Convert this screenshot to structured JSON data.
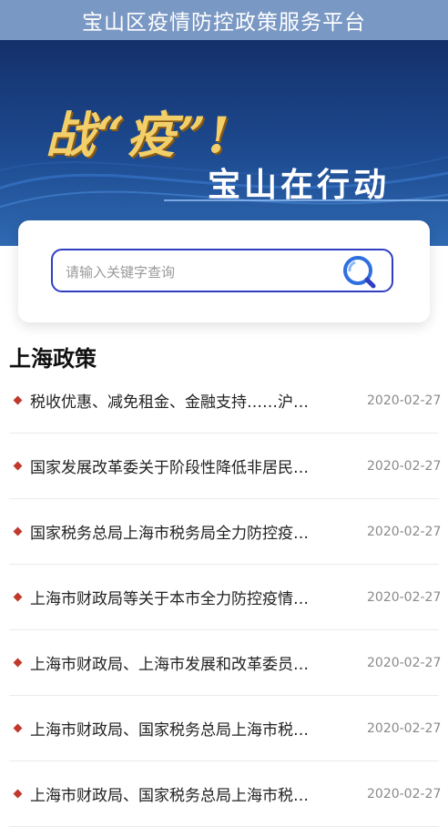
{
  "header": {
    "title": "宝山区疫情防控政策服务平台"
  },
  "banner": {
    "slogan_main": "战“疫”!",
    "slogan_sub": "宝山在行动"
  },
  "search": {
    "placeholder": "请输入关键字查询",
    "value": ""
  },
  "section": {
    "title": "上海政策"
  },
  "news": [
    {
      "title": "税收优惠、减免租金、金融支持……沪…",
      "date": "2020-02-27"
    },
    {
      "title": "国家发展改革委关于阶段性降低非居民…",
      "date": "2020-02-27"
    },
    {
      "title": "国家税务总局上海市税务局全力防控疫…",
      "date": "2020-02-27"
    },
    {
      "title": "上海市财政局等关于本市全力防控疫情…",
      "date": "2020-02-27"
    },
    {
      "title": "上海市财政局、上海市发展和改革委员…",
      "date": "2020-02-27"
    },
    {
      "title": "上海市财政局、国家税务总局上海市税…",
      "date": "2020-02-27"
    },
    {
      "title": "上海市财政局、国家税务总局上海市税…",
      "date": "2020-02-27"
    }
  ],
  "colors": {
    "header_bg": "#7a98c4",
    "search_border": "#2f3fbf",
    "bullet": "#c0392b",
    "slogan_gold": "#f3cf6a"
  }
}
